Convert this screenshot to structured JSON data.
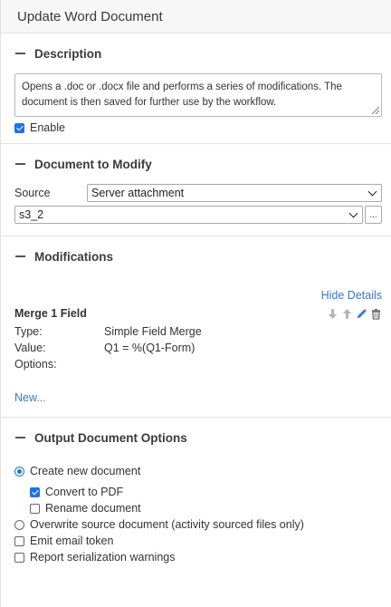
{
  "header": {
    "title": "Update Word Document"
  },
  "description": {
    "heading": "Description",
    "text": "Opens a .doc or .docx file and performs a series of modifications. The document is then saved for further use by the workflow.",
    "enable_label": "Enable",
    "enabled": true
  },
  "document": {
    "heading": "Document to Modify",
    "source_label": "Source",
    "source_value": "Server attachment",
    "file_value": "s3_2",
    "browse_label": "..."
  },
  "modifications": {
    "heading": "Modifications",
    "hide_details": "Hide Details",
    "item": {
      "title": "Merge 1 Field",
      "type_label": "Type:",
      "type_value": "Simple Field Merge",
      "value_label": "Value:",
      "value_value": "Q1 = %(Q1-Form)",
      "options_label": "Options:"
    },
    "new_link": "New..."
  },
  "output": {
    "heading": "Output Document Options",
    "create_new": "Create new document",
    "convert_pdf": "Convert to PDF",
    "rename": "Rename document",
    "overwrite": "Overwrite source document (activity sourced files only)",
    "emit_email": "Emit email token",
    "report_warnings": "Report serialization warnings"
  },
  "colors": {
    "accent": "#1a73e8",
    "link": "#3a77c3"
  }
}
